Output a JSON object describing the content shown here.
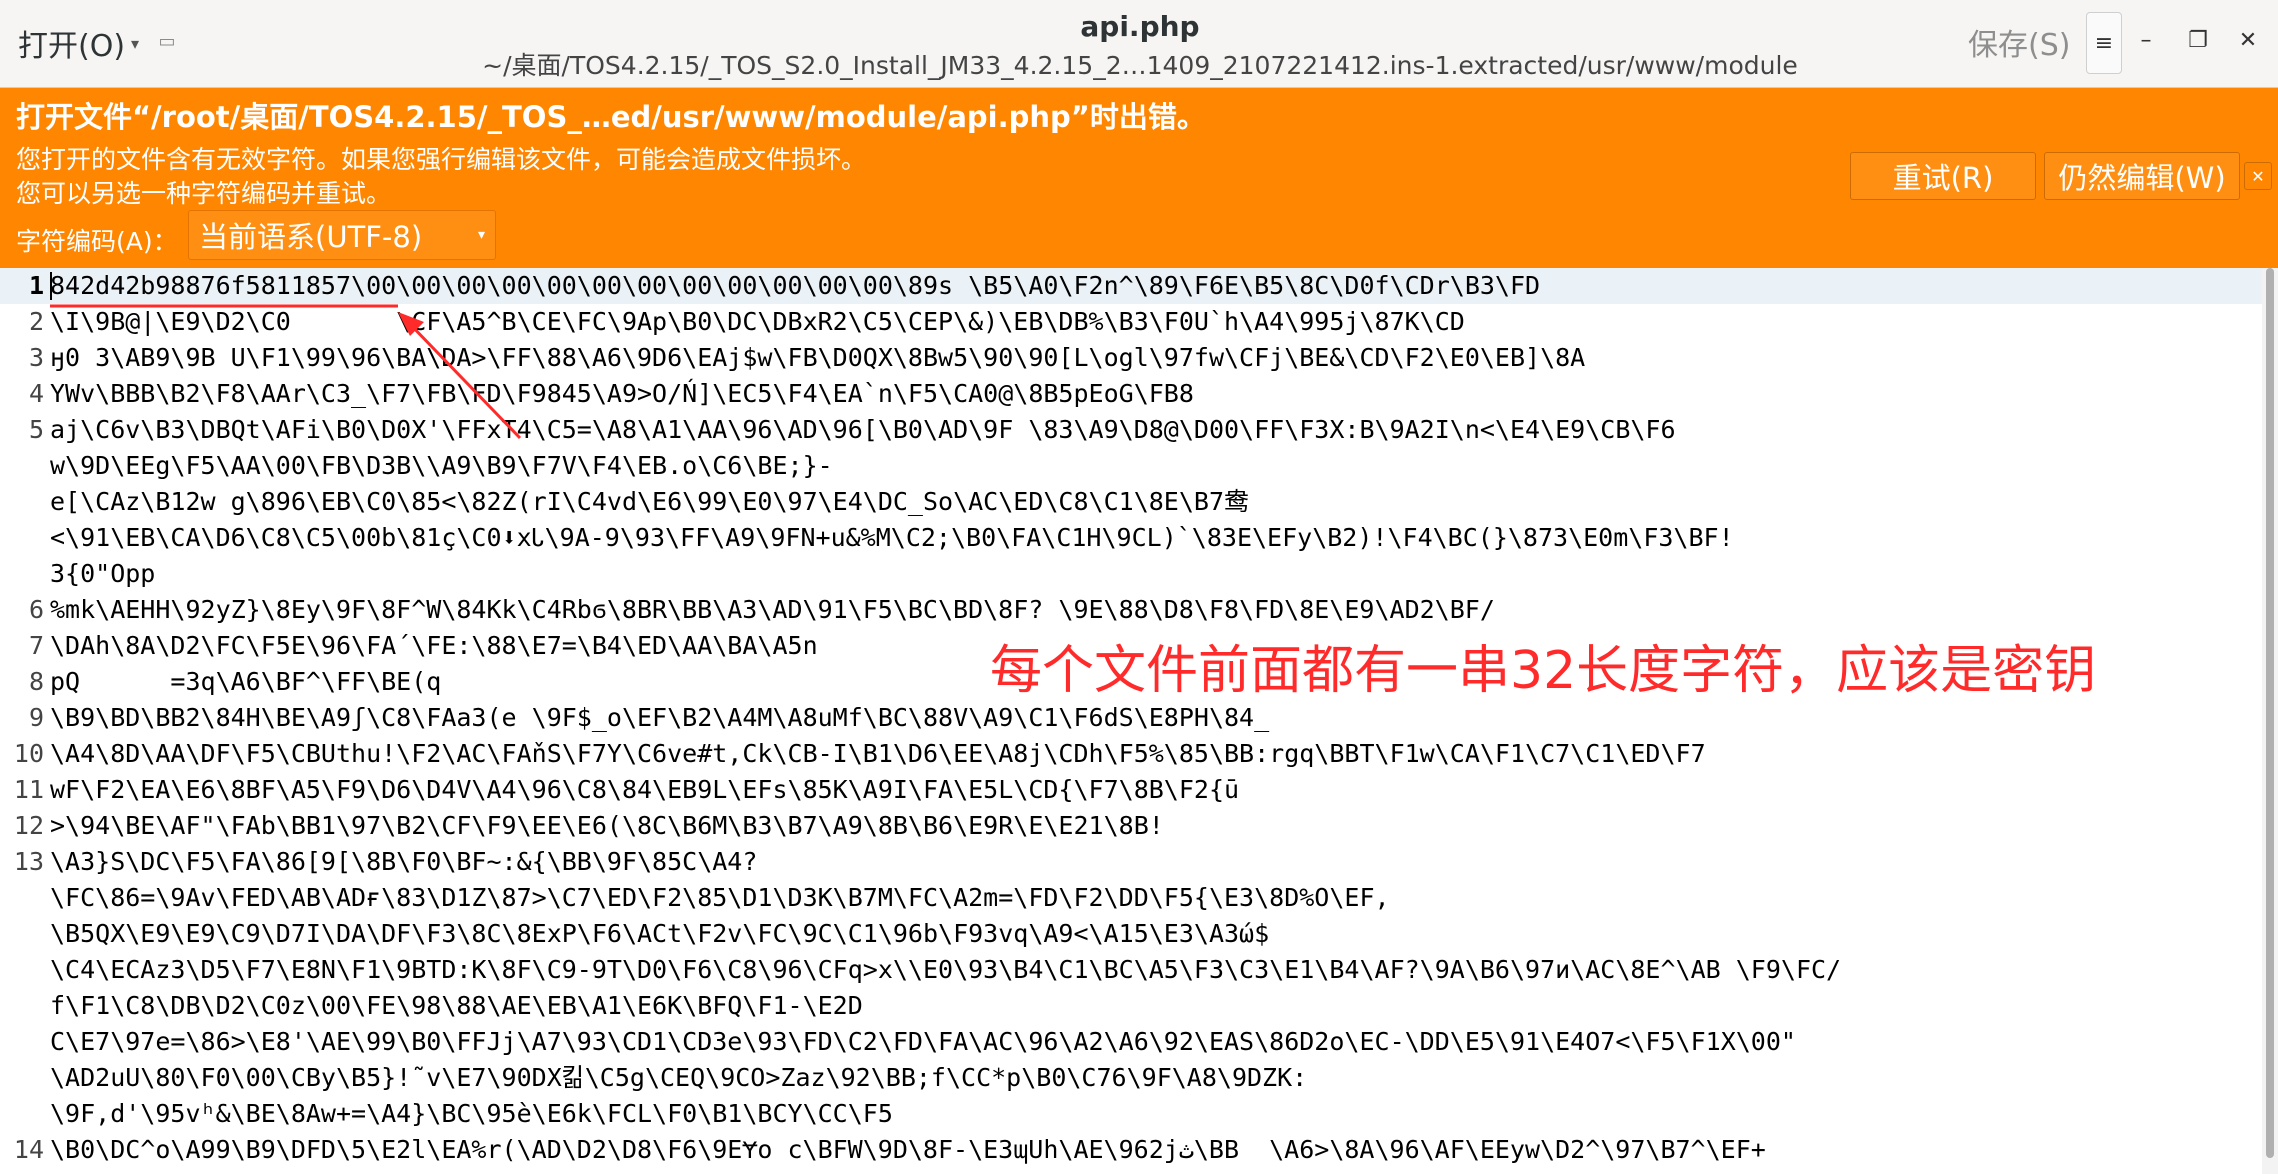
{
  "titlebar": {
    "open_label": "打开(O)",
    "title": "api.php",
    "path": "~/桌面/TOS4.2.15/_TOS_S2.0_Install_JM33_4.2.15_2…1409_2107221412.ins-1.extracted/usr/www/module",
    "save_label": "保存(S)",
    "menu_icon": "hamburger-icon",
    "minimize_icon": "minimize-icon",
    "maximize_icon": "maximize-icon",
    "close_icon": "close-icon"
  },
  "infobar": {
    "heading": "打开文件“/root/桌面/TOS4.2.15/_TOS_…ed/usr/www/module/api.php”时出错。",
    "line1": "您打开的文件含有无效字符。如果您强行编辑该文件，可能会造成文件损坏。",
    "line2": "您可以另选一种字符编码并重试。",
    "encoding_label": "字符编码(A)：",
    "encoding_value": "当前语系(UTF-8)",
    "retry_label": "重试(R)",
    "edit_anyway_label": "仍然编辑(W)",
    "color": "#ff8600"
  },
  "editor": {
    "lines": [
      {
        "n": "1",
        "text": "842d42b98876f5811857\\00\\00\\00\\00\\00\\00\\00\\00\\00\\00\\00\\00\\89s \\B5\\A0\\F2n^\\89\\F6E\\B5\\8C\\D0f\\CDr\\B3\\FD"
      },
      {
        "n": "2",
        "text": "\\I\\9B@|\\E9\\D2\\C0       \\CF\\A5^B\\CE\\FC\\9Ap\\B0\\DC\\DBxR2\\C5\\CEP\\&)\\EB\\DB%\\B3\\F0U`h\\A4\\995j\\87K\\CD"
      },
      {
        "n": "3",
        "text": "ӈ0 3\\AB9\\9B U\\F1\\99\\96\\BA\\DA>\\FF\\88\\A6\\9D6\\EAj$w\\FB\\D0QX\\8Bw5\\90\\90[L\\ogl\\97fw\\CFj\\BE&\\CD\\F2\\E0\\EB]\\8A"
      },
      {
        "n": "4",
        "text": "YWv\\BBB\\B2\\F8\\AAr\\C3_\\F7\\FB\\FD\\F9845\\A9>O/Ń]\\EC5\\F4\\EA`n\\F5\\CA0@\\8B5pEoG\\FB8"
      },
      {
        "n": "5",
        "text": "aj\\C6v\\B3\\DBQt\\AFi\\B0\\D0X'\\FFxT4\\C5=\\A8\\A1\\AA\\96\\AD\\96[\\B0\\AD\\9F \\83\\A9\\D8@\\D00\\FF\\F3X:B\\9A2I\\n<\\E4\\E9\\CB\\F6"
      },
      {
        "n": "",
        "text": "w\\9D\\EEg\\F5\\AA\\00\\FB\\D3B\\\\A9\\B9\\F7V\\F4\\EB.o\\C6\\BE;}-"
      },
      {
        "n": "",
        "text": "e[\\CAz\\B12w g\\896\\EB\\C0\\85<\\82Z(rI\\C4vd\\E6\\99\\E0\\97\\E4\\DC_So\\AC\\ED\\C8\\C1\\8E\\B7鸯"
      },
      {
        "n": "",
        "text": "<\\91\\EB\\CA\\D6\\C8\\C5\\00b\\81ç\\C0⬇xᏓ\\9A-9\\93\\FF\\A9\\9FN+u&%M\\C2;\\B0\\FA\\C1H\\9CL)`\\83E\\EFy\\B2)!\\F4\\BC(}\\873\\E0m\\F3\\BF!"
      },
      {
        "n": "",
        "text": "3{0\"Opp"
      },
      {
        "n": "6",
        "text": "%mk\\AEHH\\92yZ}\\8Ey\\9F\\8F^W\\84Kk\\C4Rbϭ\\8BR\\BB\\A3\\AD\\91\\F5\\BC\\BD\\8F? \\9E\\88\\D8\\F8\\FD\\8E\\E9\\AD2\\BF/"
      },
      {
        "n": "7",
        "text": "\\DAh\\8A\\D2\\FC\\F5E\\96\\FA´\\FE:\\88\\E7=\\B4\\ED\\AA\\BA\\A5n"
      },
      {
        "n": "8",
        "text": "pQ      =3q\\A6\\BF^\\FF\\BE(q"
      },
      {
        "n": "9",
        "text": "\\B9\\BD\\BB2\\84H\\BE\\A9ʃ\\C8\\FAa3(e \\9F$_o\\EF\\B2\\A4M\\A8uMf\\BC\\88V\\A9\\C1\\F6dS\\E8PH\\84_"
      },
      {
        "n": "10",
        "text": "\\A4\\8D\\AA\\DF\\F5\\CBUthu!\\F2\\AC\\FAňS\\F7Y\\C6ve#t,Ck\\CB-I\\B1\\D6\\EE\\A8j\\CDh\\F5%\\85\\BB:rgq\\BBT\\F1w\\CA\\F1\\C7\\C1\\ED\\F7"
      },
      {
        "n": "11",
        "text": "wF\\F2\\EA\\E6\\8BF\\A5\\F9\\D6\\D4V\\A4\\96\\C8\\84\\EB9L\\EFs\\85K\\A9I\\FA\\E5L\\CD{\\F7\\8B\\F2{ū"
      },
      {
        "n": "12",
        "text": ">\\94\\BE\\AF\"\\FAb\\BB1\\97\\B2\\CF\\F9\\EE\\E6(\\8C\\B6M\\B3\\B7\\A9\\8B\\B6\\E9R\\E\\E21\\8B!"
      },
      {
        "n": "13",
        "text": "\\A3}S\\DC\\F5\\FA\\86[9[\\8B\\F0\\BF~:&{\\BB\\9F\\85C\\A4?"
      },
      {
        "n": "",
        "text": "\\FC\\86=\\9Av\\FED\\AB\\ADғ\\83\\D1Z\\87>\\C7\\ED\\F2\\85\\D1\\D3K\\B7M\\FC\\A2m=\\FD\\F2\\DD\\F5{\\E3\\8D%O\\EF,"
      },
      {
        "n": "",
        "text": "\\B5QX\\E9\\E9\\C9\\D7I\\DA\\DF\\F3\\8C\\8ExP\\F6\\ACt\\F2v\\FC\\9C\\C1\\96b\\F93vq\\A9<\\A15\\E3\\A3ώ$"
      },
      {
        "n": "",
        "text": "\\C4\\ECAz3\\D5\\F7\\E8N\\F1\\9BTD:K\\8F\\C9-9T\\D0\\F6\\C8\\96\\CFq>x\\\\E0\\93\\B4\\C1\\BC\\A5\\F3\\C3\\E1\\B4\\AF?\\9A\\B6\\97и\\AC\\8E^\\AB \\F9\\FC/"
      },
      {
        "n": "",
        "text": "f\\F1\\C8\\DB\\D2\\C0z\\00\\FE\\98\\88\\AE\\EB\\A1\\E6K\\BFQ\\F1-\\E2D"
      },
      {
        "n": "",
        "text": "C\\E7\\97e=\\86>\\E8'\\AE\\99\\B0\\FFJj\\A7\\93\\CD1\\CD3e\\93\\FD\\C2\\FD\\FA\\AC\\96\\A2\\A6\\92\\EAS\\86D2o\\EC-\\DD\\E5\\91\\E4O7<\\F5\\F1X\\00\""
      },
      {
        "n": "",
        "text": "\\AD2uU\\80\\F0\\00\\CBy\\B5}!˜v\\E7\\90DX킮\\C5g\\CEQ\\9CO>Zaz\\92\\BB;f\\CC*p\\B0\\C76\\9F\\A8\\9DZK:"
      },
      {
        "n": "",
        "text": "\\9F,d'\\95vʰ&\\BE\\8Aw+=\\A4}\\BC\\95è\\E6k\\FCL\\F0\\B1\\BCY\\CC\\F5"
      },
      {
        "n": "14",
        "text": "\\B0\\DC^o\\A99\\B9\\DFD\\5\\E2l\\EA%r(\\AD\\D2\\D8\\F6\\9EɎo c\\BFW\\9D\\8F-\\E3ɰUh\\AE\\962jث\\BB  \\A6>\\8A\\96\\AF\\EEyw\\D2^\\97\\B7^\\EF+"
      }
    ]
  },
  "annotation": {
    "text": "每个文件前面都有一串32长度字符，应该是密钥",
    "color": "#ff2a2a"
  }
}
